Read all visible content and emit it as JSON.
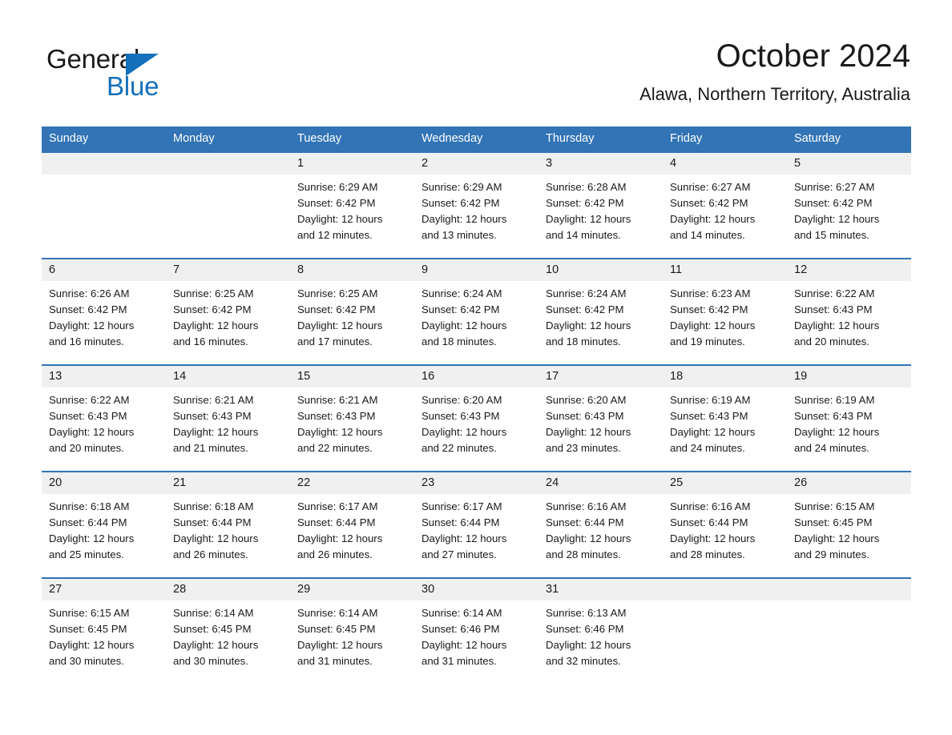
{
  "brand": {
    "name_part1": "General",
    "name_part2": "Blue",
    "triangle_color": "#1470bb"
  },
  "header": {
    "month_title": "October 2024",
    "location": "Alawa, Northern Territory, Australia"
  },
  "theme": {
    "header_blue": "#3274b5",
    "day_band_gray": "#f0f0f0",
    "text_color": "#1a1a1a",
    "page_background": "#ffffff"
  },
  "weekdays": [
    "Sunday",
    "Monday",
    "Tuesday",
    "Wednesday",
    "Thursday",
    "Friday",
    "Saturday"
  ],
  "weeks": [
    [
      {
        "day": "",
        "empty": true,
        "sunrise": "",
        "sunset": "",
        "daylight_line1": "",
        "daylight_line2": ""
      },
      {
        "day": "",
        "empty": true,
        "sunrise": "",
        "sunset": "",
        "daylight_line1": "",
        "daylight_line2": ""
      },
      {
        "day": "1",
        "empty": false,
        "sunrise": "Sunrise: 6:29 AM",
        "sunset": "Sunset: 6:42 PM",
        "daylight_line1": "Daylight: 12 hours",
        "daylight_line2": "and 12 minutes."
      },
      {
        "day": "2",
        "empty": false,
        "sunrise": "Sunrise: 6:29 AM",
        "sunset": "Sunset: 6:42 PM",
        "daylight_line1": "Daylight: 12 hours",
        "daylight_line2": "and 13 minutes."
      },
      {
        "day": "3",
        "empty": false,
        "sunrise": "Sunrise: 6:28 AM",
        "sunset": "Sunset: 6:42 PM",
        "daylight_line1": "Daylight: 12 hours",
        "daylight_line2": "and 14 minutes."
      },
      {
        "day": "4",
        "empty": false,
        "sunrise": "Sunrise: 6:27 AM",
        "sunset": "Sunset: 6:42 PM",
        "daylight_line1": "Daylight: 12 hours",
        "daylight_line2": "and 14 minutes."
      },
      {
        "day": "5",
        "empty": false,
        "sunrise": "Sunrise: 6:27 AM",
        "sunset": "Sunset: 6:42 PM",
        "daylight_line1": "Daylight: 12 hours",
        "daylight_line2": "and 15 minutes."
      }
    ],
    [
      {
        "day": "6",
        "empty": false,
        "sunrise": "Sunrise: 6:26 AM",
        "sunset": "Sunset: 6:42 PM",
        "daylight_line1": "Daylight: 12 hours",
        "daylight_line2": "and 16 minutes."
      },
      {
        "day": "7",
        "empty": false,
        "sunrise": "Sunrise: 6:25 AM",
        "sunset": "Sunset: 6:42 PM",
        "daylight_line1": "Daylight: 12 hours",
        "daylight_line2": "and 16 minutes."
      },
      {
        "day": "8",
        "empty": false,
        "sunrise": "Sunrise: 6:25 AM",
        "sunset": "Sunset: 6:42 PM",
        "daylight_line1": "Daylight: 12 hours",
        "daylight_line2": "and 17 minutes."
      },
      {
        "day": "9",
        "empty": false,
        "sunrise": "Sunrise: 6:24 AM",
        "sunset": "Sunset: 6:42 PM",
        "daylight_line1": "Daylight: 12 hours",
        "daylight_line2": "and 18 minutes."
      },
      {
        "day": "10",
        "empty": false,
        "sunrise": "Sunrise: 6:24 AM",
        "sunset": "Sunset: 6:42 PM",
        "daylight_line1": "Daylight: 12 hours",
        "daylight_line2": "and 18 minutes."
      },
      {
        "day": "11",
        "empty": false,
        "sunrise": "Sunrise: 6:23 AM",
        "sunset": "Sunset: 6:42 PM",
        "daylight_line1": "Daylight: 12 hours",
        "daylight_line2": "and 19 minutes."
      },
      {
        "day": "12",
        "empty": false,
        "sunrise": "Sunrise: 6:22 AM",
        "sunset": "Sunset: 6:43 PM",
        "daylight_line1": "Daylight: 12 hours",
        "daylight_line2": "and 20 minutes."
      }
    ],
    [
      {
        "day": "13",
        "empty": false,
        "sunrise": "Sunrise: 6:22 AM",
        "sunset": "Sunset: 6:43 PM",
        "daylight_line1": "Daylight: 12 hours",
        "daylight_line2": "and 20 minutes."
      },
      {
        "day": "14",
        "empty": false,
        "sunrise": "Sunrise: 6:21 AM",
        "sunset": "Sunset: 6:43 PM",
        "daylight_line1": "Daylight: 12 hours",
        "daylight_line2": "and 21 minutes."
      },
      {
        "day": "15",
        "empty": false,
        "sunrise": "Sunrise: 6:21 AM",
        "sunset": "Sunset: 6:43 PM",
        "daylight_line1": "Daylight: 12 hours",
        "daylight_line2": "and 22 minutes."
      },
      {
        "day": "16",
        "empty": false,
        "sunrise": "Sunrise: 6:20 AM",
        "sunset": "Sunset: 6:43 PM",
        "daylight_line1": "Daylight: 12 hours",
        "daylight_line2": "and 22 minutes."
      },
      {
        "day": "17",
        "empty": false,
        "sunrise": "Sunrise: 6:20 AM",
        "sunset": "Sunset: 6:43 PM",
        "daylight_line1": "Daylight: 12 hours",
        "daylight_line2": "and 23 minutes."
      },
      {
        "day": "18",
        "empty": false,
        "sunrise": "Sunrise: 6:19 AM",
        "sunset": "Sunset: 6:43 PM",
        "daylight_line1": "Daylight: 12 hours",
        "daylight_line2": "and 24 minutes."
      },
      {
        "day": "19",
        "empty": false,
        "sunrise": "Sunrise: 6:19 AM",
        "sunset": "Sunset: 6:43 PM",
        "daylight_line1": "Daylight: 12 hours",
        "daylight_line2": "and 24 minutes."
      }
    ],
    [
      {
        "day": "20",
        "empty": false,
        "sunrise": "Sunrise: 6:18 AM",
        "sunset": "Sunset: 6:44 PM",
        "daylight_line1": "Daylight: 12 hours",
        "daylight_line2": "and 25 minutes."
      },
      {
        "day": "21",
        "empty": false,
        "sunrise": "Sunrise: 6:18 AM",
        "sunset": "Sunset: 6:44 PM",
        "daylight_line1": "Daylight: 12 hours",
        "daylight_line2": "and 26 minutes."
      },
      {
        "day": "22",
        "empty": false,
        "sunrise": "Sunrise: 6:17 AM",
        "sunset": "Sunset: 6:44 PM",
        "daylight_line1": "Daylight: 12 hours",
        "daylight_line2": "and 26 minutes."
      },
      {
        "day": "23",
        "empty": false,
        "sunrise": "Sunrise: 6:17 AM",
        "sunset": "Sunset: 6:44 PM",
        "daylight_line1": "Daylight: 12 hours",
        "daylight_line2": "and 27 minutes."
      },
      {
        "day": "24",
        "empty": false,
        "sunrise": "Sunrise: 6:16 AM",
        "sunset": "Sunset: 6:44 PM",
        "daylight_line1": "Daylight: 12 hours",
        "daylight_line2": "and 28 minutes."
      },
      {
        "day": "25",
        "empty": false,
        "sunrise": "Sunrise: 6:16 AM",
        "sunset": "Sunset: 6:44 PM",
        "daylight_line1": "Daylight: 12 hours",
        "daylight_line2": "and 28 minutes."
      },
      {
        "day": "26",
        "empty": false,
        "sunrise": "Sunrise: 6:15 AM",
        "sunset": "Sunset: 6:45 PM",
        "daylight_line1": "Daylight: 12 hours",
        "daylight_line2": "and 29 minutes."
      }
    ],
    [
      {
        "day": "27",
        "empty": false,
        "sunrise": "Sunrise: 6:15 AM",
        "sunset": "Sunset: 6:45 PM",
        "daylight_line1": "Daylight: 12 hours",
        "daylight_line2": "and 30 minutes."
      },
      {
        "day": "28",
        "empty": false,
        "sunrise": "Sunrise: 6:14 AM",
        "sunset": "Sunset: 6:45 PM",
        "daylight_line1": "Daylight: 12 hours",
        "daylight_line2": "and 30 minutes."
      },
      {
        "day": "29",
        "empty": false,
        "sunrise": "Sunrise: 6:14 AM",
        "sunset": "Sunset: 6:45 PM",
        "daylight_line1": "Daylight: 12 hours",
        "daylight_line2": "and 31 minutes."
      },
      {
        "day": "30",
        "empty": false,
        "sunrise": "Sunrise: 6:14 AM",
        "sunset": "Sunset: 6:46 PM",
        "daylight_line1": "Daylight: 12 hours",
        "daylight_line2": "and 31 minutes."
      },
      {
        "day": "31",
        "empty": false,
        "sunrise": "Sunrise: 6:13 AM",
        "sunset": "Sunset: 6:46 PM",
        "daylight_line1": "Daylight: 12 hours",
        "daylight_line2": "and 32 minutes."
      },
      {
        "day": "",
        "empty": true,
        "sunrise": "",
        "sunset": "",
        "daylight_line1": "",
        "daylight_line2": ""
      },
      {
        "day": "",
        "empty": true,
        "sunrise": "",
        "sunset": "",
        "daylight_line1": "",
        "daylight_line2": ""
      }
    ]
  ]
}
